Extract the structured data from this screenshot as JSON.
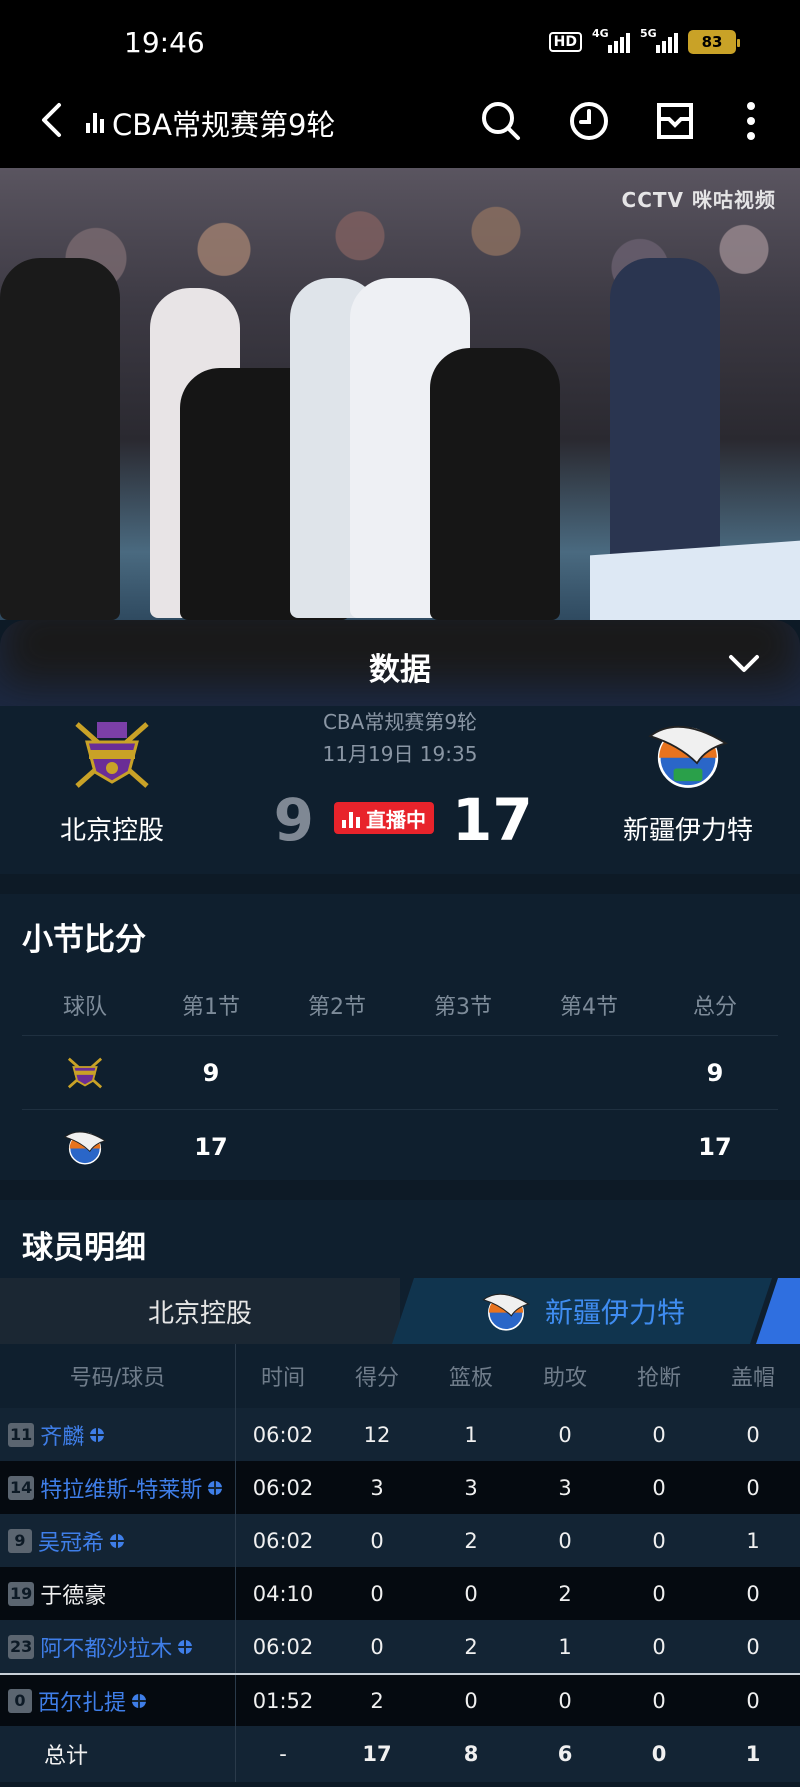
{
  "status_bar": {
    "time": "19:46",
    "hd": "HD",
    "net_4g": "4G",
    "net_5g": "5G",
    "battery": "83"
  },
  "header": {
    "title": "CBA常规赛第9轮"
  },
  "video": {
    "watermark": "CCTV 咪咕视频"
  },
  "panel": {
    "title": "数据"
  },
  "match": {
    "competition": "CBA常规赛第9轮",
    "datetime": "11月19日 19:35",
    "home": {
      "name": "北京控股",
      "score": "9"
    },
    "away": {
      "name": "新疆伊力特",
      "score": "17"
    },
    "live_label": "直播中"
  },
  "quarters": {
    "title": "小节比分",
    "headers": [
      "球队",
      "第1节",
      "第2节",
      "第3节",
      "第4节",
      "总分"
    ],
    "rows": [
      {
        "q1": "9",
        "q2": "",
        "q3": "",
        "q4": "",
        "total": "9"
      },
      {
        "q1": "17",
        "q2": "",
        "q3": "",
        "q4": "",
        "total": "17"
      }
    ]
  },
  "players": {
    "title": "球员明细",
    "tab_home": "北京控股",
    "tab_away": "新疆伊力特",
    "headers": [
      "号码/球员",
      "时间",
      "得分",
      "篮板",
      "助攻",
      "抢断",
      "盖帽"
    ],
    "rows": [
      {
        "num": "11",
        "name": "齐麟",
        "starter": true,
        "time": "06:02",
        "pts": "12",
        "reb": "1",
        "ast": "0",
        "stl": "0",
        "blk": "0"
      },
      {
        "num": "14",
        "name": "特拉维斯-特莱斯",
        "starter": true,
        "time": "06:02",
        "pts": "3",
        "reb": "3",
        "ast": "3",
        "stl": "0",
        "blk": "0"
      },
      {
        "num": "9",
        "name": "吴冠希",
        "starter": true,
        "time": "06:02",
        "pts": "0",
        "reb": "2",
        "ast": "0",
        "stl": "0",
        "blk": "1"
      },
      {
        "num": "19",
        "name": "于德豪",
        "starter": false,
        "time": "04:10",
        "pts": "0",
        "reb": "0",
        "ast": "2",
        "stl": "0",
        "blk": "0"
      },
      {
        "num": "23",
        "name": "阿不都沙拉木",
        "starter": true,
        "time": "06:02",
        "pts": "0",
        "reb": "2",
        "ast": "1",
        "stl": "0",
        "blk": "0"
      },
      {
        "num": "0",
        "name": "西尔扎提",
        "starter": true,
        "time": "01:52",
        "pts": "2",
        "reb": "0",
        "ast": "0",
        "stl": "0",
        "blk": "0"
      }
    ],
    "total": {
      "label": "总计",
      "time": "-",
      "pts": "17",
      "reb": "8",
      "ast": "6",
      "stl": "0",
      "blk": "1"
    }
  },
  "colors": {
    "live_red": "#e8232b",
    "link_blue": "#3f7ee8",
    "panel_bg": "#0f1f2e"
  }
}
